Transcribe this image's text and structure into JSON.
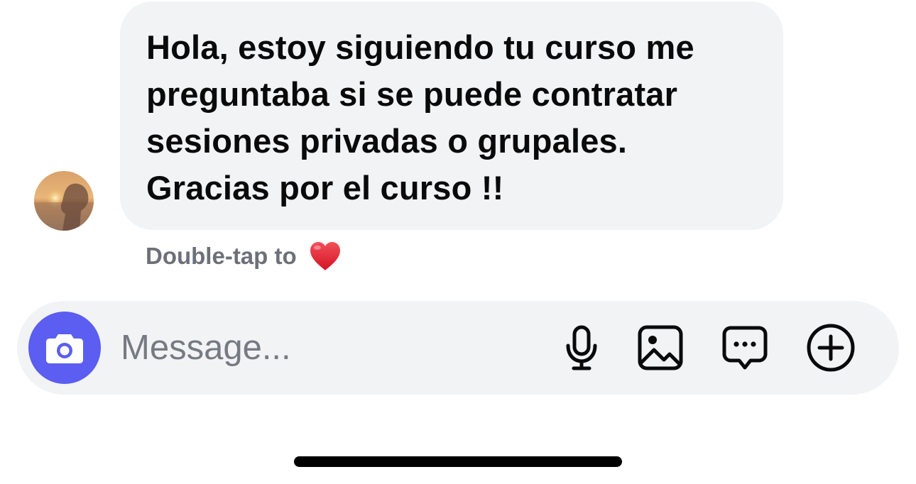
{
  "message": {
    "text": "Hola, estoy siguiendo tu curso me\npreguntaba si se puede contratar\nsesiones privadas o grupales.\nGracias por el curso !!"
  },
  "reaction_hint": {
    "label": "Double-tap to",
    "emoji": "heart-icon"
  },
  "composer": {
    "placeholder": "Message...",
    "value": "",
    "icons": [
      "camera-icon",
      "microphone-icon",
      "image-icon",
      "chat-bubble-icon",
      "plus-circle-icon"
    ]
  },
  "colors": {
    "bubble": "#f2f3f5",
    "composer": "#f2f3f5",
    "camera_button": "#5b5ef0",
    "heart": "#e0202e",
    "hint_text": "#6d7079",
    "placeholder_text": "#767a82"
  }
}
